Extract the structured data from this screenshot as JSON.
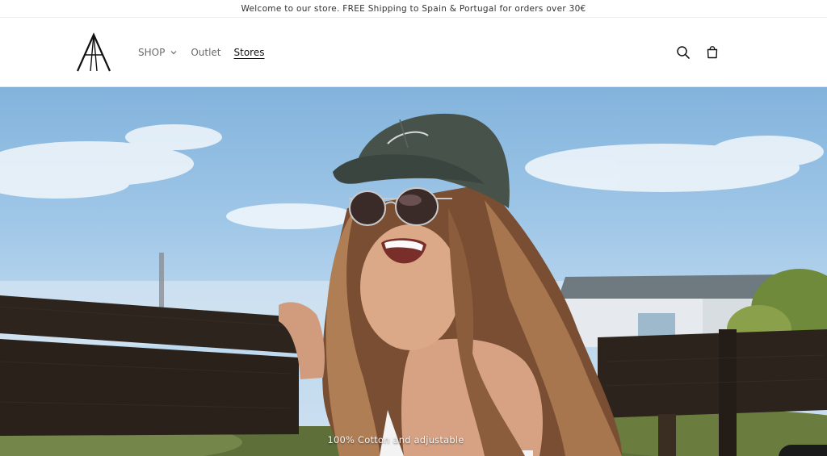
{
  "announcement": {
    "text": "Welcome to our store. FREE Shipping to Spain & Portugal for orders over 30€"
  },
  "header": {
    "logo_letter": "A",
    "nav": [
      {
        "label": "SHOP",
        "has_dropdown": true
      },
      {
        "label": "Outlet",
        "has_dropdown": false
      },
      {
        "label": "Stores",
        "active": true
      }
    ],
    "icons": [
      "search-icon",
      "cart-icon"
    ]
  },
  "hero": {
    "caption": "100% Cotton and adjustable"
  },
  "colors": {
    "sky": "#9ec6e7",
    "fence": "#2b231c",
    "cap": "#3f4b41",
    "hair": "#8a5a3c",
    "skin": "#d8a585",
    "text": "#121212",
    "muted_text": "#6b6b6b"
  }
}
